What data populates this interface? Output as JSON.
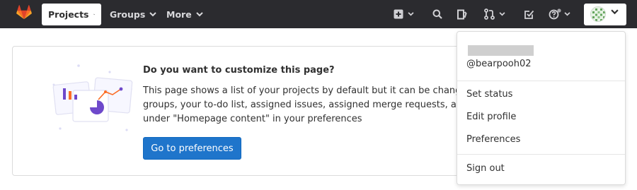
{
  "navbar": {
    "projects_label": "Projects",
    "groups_label": "Groups",
    "more_label": "More"
  },
  "card": {
    "title": "Do you want to customize this page?",
    "body_lines": [
      "This page shows a list of your projects by default but it can be changed",
      "groups, your to-do list, assigned issues, assigned merge requests, and",
      "under \"Homepage content\" in your preferences"
    ],
    "button_label": "Go to preferences"
  },
  "user_menu": {
    "username": "@bearpooh02",
    "items": [
      "Set status",
      "Edit profile",
      "Preferences",
      "Sign out"
    ]
  },
  "colors": {
    "navbar_bg": "#2b2b2f",
    "primary_button": "#1f75cb",
    "gitlab_orange": "#e24329"
  }
}
